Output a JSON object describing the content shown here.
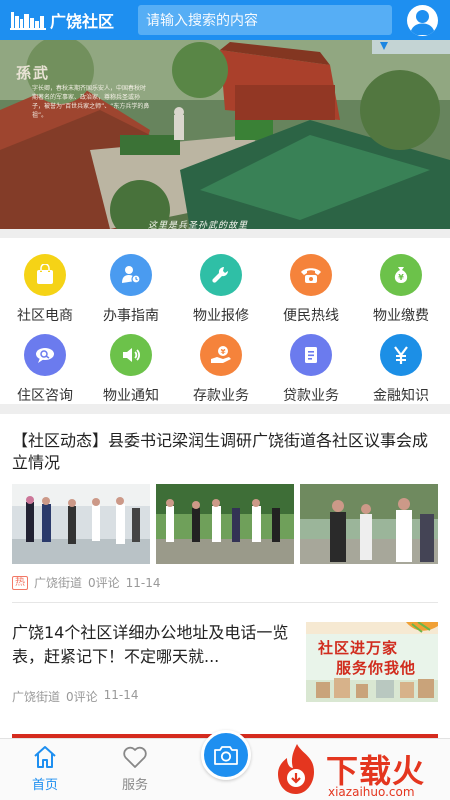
{
  "header": {
    "app_name": "广饶社区",
    "search_placeholder": "请输入搜索的内容"
  },
  "banner": {
    "title": "孫武",
    "caption": "字长卿，春秋末期齐国乐安人，中国春秋时期著名的军事家、政治家，尊称兵圣或孙子，被誉为“百世兵家之师”、“东方兵学的鼻祖”。",
    "footer": "这里是兵圣孙武的故里"
  },
  "services": [
    {
      "label": "社区电商",
      "icon": "shopping-bag-icon",
      "color": "#f5d316"
    },
    {
      "label": "办事指南",
      "icon": "person-guide-icon",
      "color": "#4a9bf0"
    },
    {
      "label": "物业报修",
      "icon": "wrench-icon",
      "color": "#2fbfa6"
    },
    {
      "label": "便民热线",
      "icon": "phone-icon",
      "color": "#f5833b"
    },
    {
      "label": "物业缴费",
      "icon": "money-bag-icon",
      "color": "#6cc24a"
    },
    {
      "label": "住区咨询",
      "icon": "chat-search-icon",
      "color": "#6b7bee"
    },
    {
      "label": "物业通知",
      "icon": "speaker-icon",
      "color": "#6cc24a"
    },
    {
      "label": "存款业务",
      "icon": "deposit-hand-icon",
      "color": "#f5833b"
    },
    {
      "label": "贷款业务",
      "icon": "document-icon",
      "color": "#6b7bee"
    },
    {
      "label": "金融知识",
      "icon": "yuan-icon",
      "color": "#1c8fe6"
    }
  ],
  "news": [
    {
      "title": "【社区动态】县委书记梁润生调研广饶街道各社区议事会成立情况",
      "badge": "热",
      "source": "广饶街道",
      "comments": "0评论",
      "date": "11-14"
    },
    {
      "title": "广饶14个社区详细办公地址及电话一览表，赶紧记下！不定哪天就...",
      "source": "广饶街道",
      "comments": "0评论",
      "date": "11-14",
      "image_text_1": "社区进万家",
      "image_text_2": "服务你我他"
    }
  ],
  "bottom_nav": {
    "home": "首页",
    "service": "服务"
  },
  "watermark": {
    "text": "下载火",
    "url": "xiazaihuo.com"
  },
  "colors": {
    "primary": "#1e8ff0",
    "active_nav": "#1e8ff0",
    "inactive_nav": "#888888",
    "hot": "#f27866"
  }
}
